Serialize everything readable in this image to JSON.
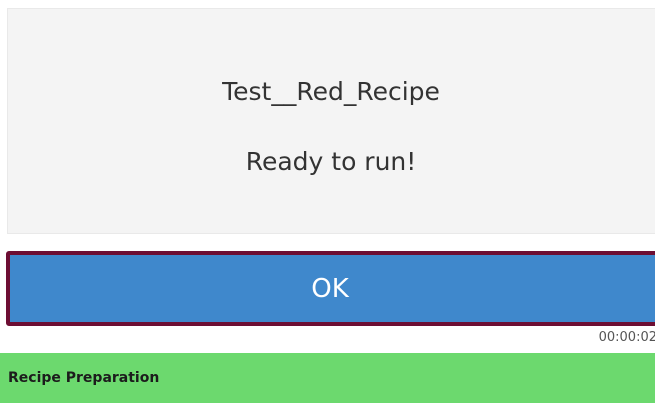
{
  "dialog": {
    "recipe_name": "Test__Red_Recipe",
    "status_message": "Ready to run!"
  },
  "ok_button": {
    "label": "OK",
    "color": "#3f88cc",
    "border_color": "#6d0e33"
  },
  "timer": {
    "elapsed": "00:00:02"
  },
  "stage_bar": {
    "label": "Recipe Preparation",
    "color": "#6cd96e"
  }
}
